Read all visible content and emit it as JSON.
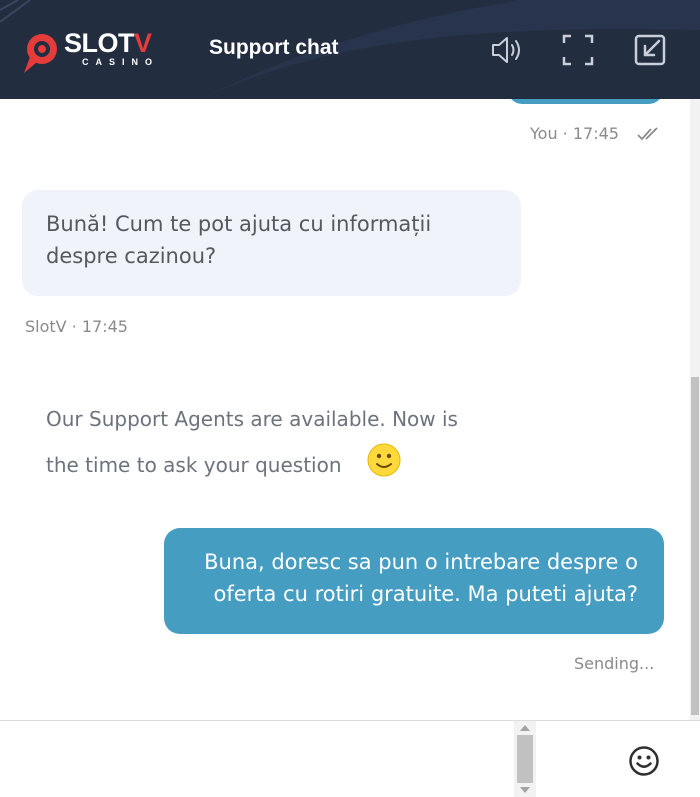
{
  "header": {
    "brand": "SLOTV",
    "brand_main": "SLOT",
    "brand_accent": "V",
    "brand_sub": "CASINO",
    "title": "Support chat",
    "icons": [
      "speaker-icon",
      "fullscreen-icon",
      "minimize-icon"
    ]
  },
  "messages": [
    {
      "author": "You",
      "time": "17:45",
      "meta": "You · 17:45",
      "status_icon": "double-check-icon"
    },
    {
      "author": "SlotV",
      "time": "17:45",
      "meta": "SlotV · 17:45",
      "text": "Bună! Cum te pot ajuta cu informații despre cazinou?"
    },
    {
      "type": "system",
      "text": "Our Support Agents are available. Now is the time to ask your question",
      "icon": "smiley-emoji"
    },
    {
      "author": "You",
      "text": "Buna, doresc sa pun o intrebare despre o oferta cu rotiri gratuite. Ma puteti ajuta?",
      "status": "Sending..."
    }
  ],
  "composer": {
    "value": "",
    "emoji_icon": "smiley-icon"
  },
  "colors": {
    "header_bg": "#222d40",
    "brand_accent": "#e43b3b",
    "outgoing_bubble": "#469dc2",
    "incoming_bubble": "#f0f3f9"
  }
}
